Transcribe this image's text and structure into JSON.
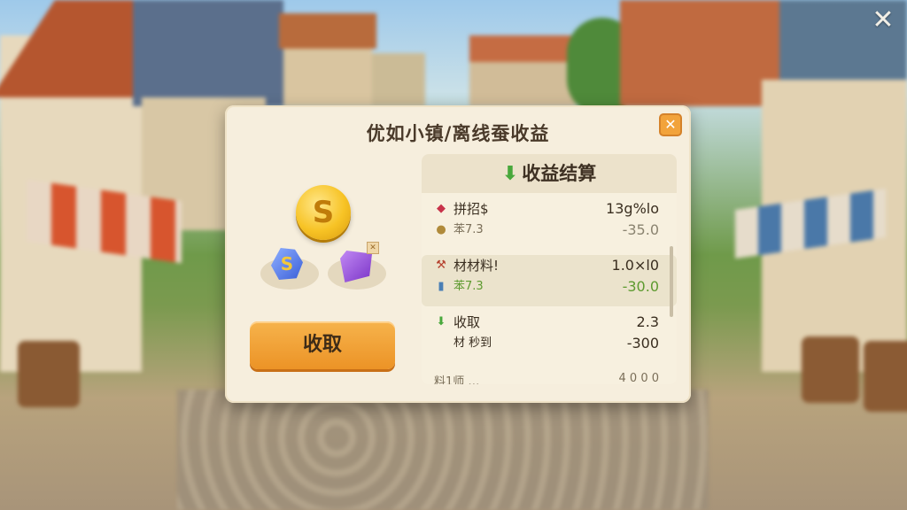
{
  "screen": {
    "close_label": "✕"
  },
  "dialog": {
    "title": "优如小镇/离线蚕收益",
    "close_label": "✕",
    "coin_symbol": "S",
    "gem_symbol": "S",
    "collect_label": "收取",
    "panel": {
      "header_icon": "down-arrow-icon",
      "header": "收益结算",
      "rows": [
        {
          "icon": "red-gem-icon",
          "label": "拼招$",
          "value": "13g%lo",
          "sub_icon": "coin-bag-icon",
          "sub_label": "苯7.3",
          "sub_value": "-35.0"
        },
        {
          "icon": "hammer-icon",
          "label": "材材料!",
          "value": "1.0×l0",
          "sub_icon": "book-icon",
          "sub_label": "苯7.3",
          "sub_value": "-30.0"
        },
        {
          "icon": "down-arrow-icon",
          "label": "收取",
          "value": "2.3",
          "sub_icon": "material-icon",
          "sub_label": "材 秒到",
          "sub_value": "-300"
        }
      ],
      "partial_row": {
        "label": "料1师 …",
        "value": "4 0 0 0"
      }
    }
  },
  "colors": {
    "accent_orange": "#f2a33b",
    "green": "#5d9a2f",
    "panel_bg": "#f6eedd"
  }
}
